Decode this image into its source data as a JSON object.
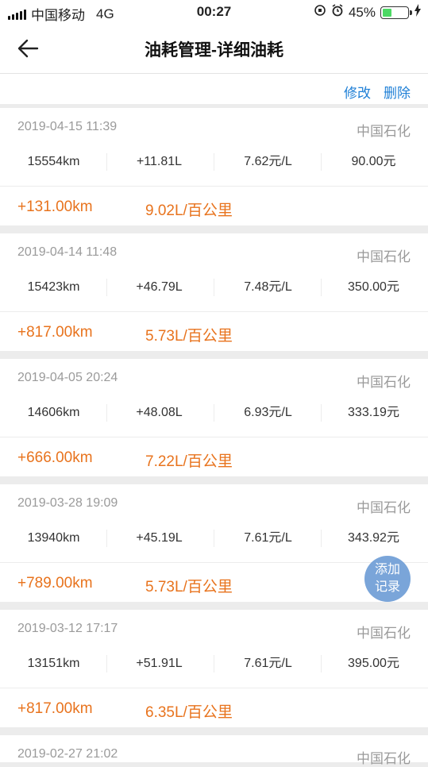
{
  "status_bar": {
    "carrier": "中国移动",
    "network": "4G",
    "time": "00:27",
    "battery_percent": "45%",
    "battery_level": 0.45
  },
  "nav": {
    "title": "油耗管理-详细油耗",
    "back_icon": "arrow-left-icon"
  },
  "actions": {
    "edit": "修改",
    "delete": "删除"
  },
  "records": [
    {
      "datetime": "2019-04-15 11:39",
      "station": "中国石化",
      "odometer": "15554km",
      "volume": "+11.81L",
      "price": "7.62元/L",
      "amount": "90.00元",
      "distance": "+131.00km",
      "consumption": "9.02L/百公里"
    },
    {
      "datetime": "2019-04-14 11:48",
      "station": "中国石化",
      "odometer": "15423km",
      "volume": "+46.79L",
      "price": "7.48元/L",
      "amount": "350.00元",
      "distance": "+817.00km",
      "consumption": "5.73L/百公里"
    },
    {
      "datetime": "2019-04-05 20:24",
      "station": "中国石化",
      "odometer": "14606km",
      "volume": "+48.08L",
      "price": "6.93元/L",
      "amount": "333.19元",
      "distance": "+666.00km",
      "consumption": "7.22L/百公里"
    },
    {
      "datetime": "2019-03-28 19:09",
      "station": "中国石化",
      "odometer": "13940km",
      "volume": "+45.19L",
      "price": "7.61元/L",
      "amount": "343.92元",
      "distance": "+789.00km",
      "consumption": "5.73L/百公里"
    },
    {
      "datetime": "2019-03-12 17:17",
      "station": "中国石化",
      "odometer": "13151km",
      "volume": "+51.91L",
      "price": "7.61元/L",
      "amount": "395.00元",
      "distance": "+817.00km",
      "consumption": "6.35L/百公里"
    },
    {
      "datetime": "2019-02-27 21:02",
      "station": "中国石化"
    }
  ],
  "fab": {
    "line1": "添加",
    "line2": "记录"
  },
  "colors": {
    "accent_blue": "#1e7fd6",
    "orange": "#e8731d",
    "fab": "#7aa5d9"
  }
}
